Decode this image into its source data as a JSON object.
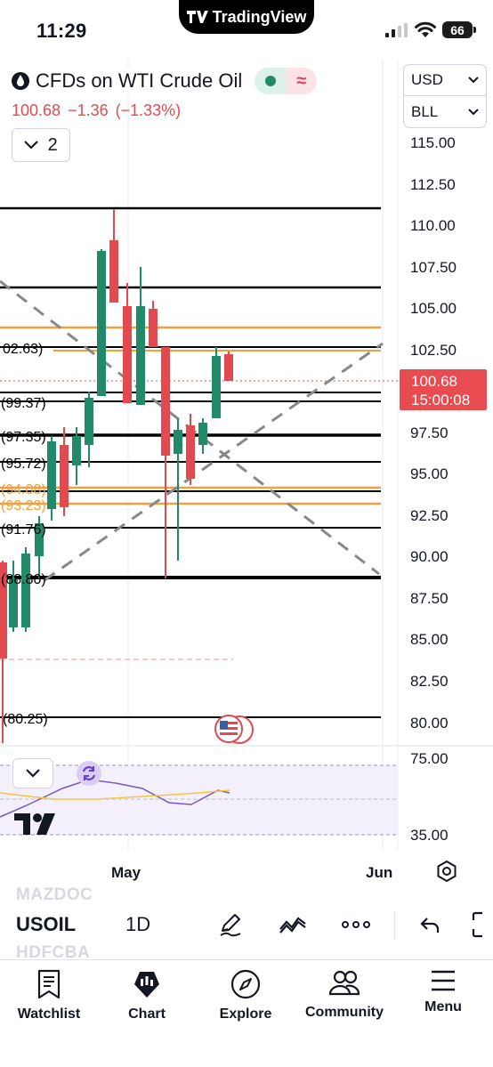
{
  "status_bar": {
    "time": "11:29",
    "app_pill": "TradingView",
    "battery": "66"
  },
  "header": {
    "symbol_name": "CFDs on WTI Crude Oil",
    "market_status": "open",
    "delay_glyph": "≈",
    "last_price": "100.68",
    "change": "−1.36",
    "change_pct": "(−1.33%)",
    "collapse_count": "2",
    "currency": "USD",
    "unit": "BLL"
  },
  "price_axis": {
    "labels": [
      "115.00",
      "112.50",
      "110.00",
      "107.50",
      "105.00",
      "102.50",
      "97.50",
      "95.00",
      "92.50",
      "90.00",
      "87.50",
      "85.00",
      "82.50",
      "80.00"
    ],
    "current_price": "100.68",
    "countdown": "15:00:08"
  },
  "level_labels": [
    "02.63)",
    "(99.37)",
    "(97.35)",
    "(95.72)",
    "(94.08)",
    "(93.23)",
    "(91.76)",
    "(88.80)",
    "(80.25)"
  ],
  "time_axis": {
    "labels": [
      "May",
      "Jun"
    ]
  },
  "indicator_axis": {
    "labels": [
      "75.00",
      "35.00"
    ]
  },
  "colors": {
    "up": "#22896a",
    "down": "#e24a4f",
    "fib": "#f2a03b",
    "level": "#000000",
    "indicator": "#7e57c2",
    "indicator_ma": "#f5c542"
  },
  "icons": [
    "drop-icon",
    "chevron-down-icon",
    "flag-us-icon",
    "sync-icon",
    "tradingview-logo",
    "settings-icon",
    "pen-icon",
    "indicators-icon",
    "more-icon",
    "undo-icon",
    "fullscreen-icon",
    "watchlist-icon",
    "chart-icon",
    "explore-icon",
    "community-icon",
    "menu-icon"
  ],
  "toolbar": {
    "symbol": "USOIL",
    "interval": "1D",
    "ghost_top": "MAZDOC",
    "ghost_bottom": "HDFCBA"
  },
  "nav": {
    "items": [
      {
        "label": "Watchlist"
      },
      {
        "label": "Chart"
      },
      {
        "label": "Explore"
      },
      {
        "label": "Community"
      },
      {
        "label": "Menu"
      }
    ]
  }
}
